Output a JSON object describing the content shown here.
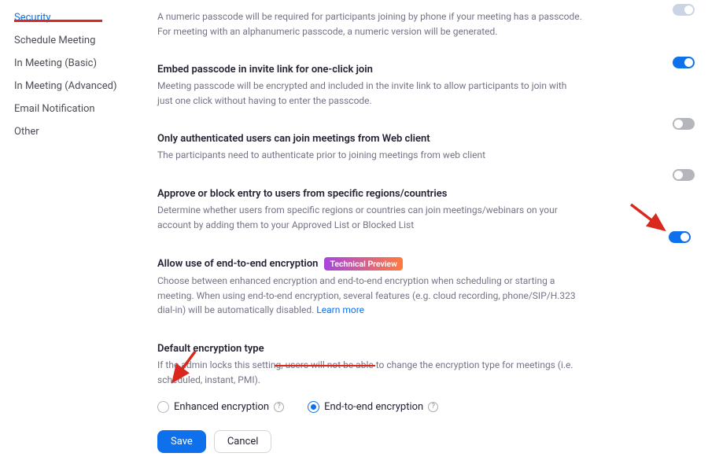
{
  "sidebar": {
    "items": [
      {
        "label": "Security"
      },
      {
        "label": "Schedule Meeting"
      },
      {
        "label": "In Meeting (Basic)"
      },
      {
        "label": "In Meeting (Advanced)"
      },
      {
        "label": "Email Notification"
      },
      {
        "label": "Other"
      }
    ]
  },
  "settings": {
    "passcode_numeric": {
      "desc": "A numeric passcode will be required for participants joining by phone if your meeting has a passcode. For meeting with an alphanumeric passcode, a numeric version will be generated."
    },
    "embed_passcode": {
      "title": "Embed passcode in invite link for one-click join",
      "desc": "Meeting passcode will be encrypted and included in the invite link to allow participants to join with just one click without having to enter the passcode."
    },
    "auth_web": {
      "title": "Only authenticated users can join meetings from Web client",
      "desc": "The participants need to authenticate prior to joining meetings from web client"
    },
    "regions": {
      "title": "Approve or block entry to users from specific regions/countries",
      "desc": "Determine whether users from specific regions or countries can join meetings/webinars on your account by adding them to your Approved List or Blocked List"
    },
    "e2e": {
      "title": "Allow use of end-to-end encryption",
      "badge": "Technical Preview",
      "desc_pre": "Choose between enhanced encryption and end-to-end encryption when scheduling or starting a meeting. When using end-to-end encryption, several features (e.g. cloud recording, phone/SIP/H.323 dial-in) will be automatically disabled. ",
      "learn_more": "Learn more"
    },
    "default_enc": {
      "title": "Default encryption type",
      "desc": "If the admin locks this setting, users will not be able to change the encryption type for meetings (i.e. scheduled, instant, PMI).",
      "opt_enhanced": "Enhanced encryption",
      "opt_e2e": "End-to-end encryption"
    }
  },
  "buttons": {
    "save": "Save",
    "cancel": "Cancel"
  },
  "toggles": {
    "passcode_numeric": "partial",
    "embed_passcode": "on",
    "auth_web": "off",
    "regions": "off",
    "e2e": "on"
  }
}
